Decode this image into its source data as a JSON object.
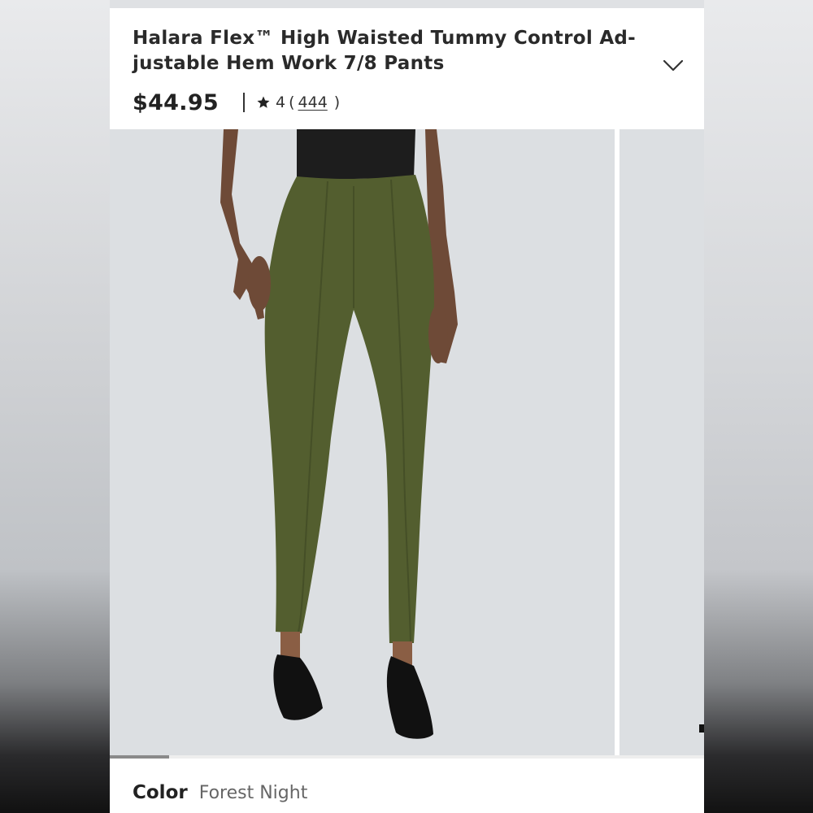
{
  "product": {
    "title": "Halara Flex™ High Waisted Tummy Control Ad-justable Hem Work 7/8 Pants",
    "price": "$44.95",
    "rating": "4",
    "review_count": "444",
    "paren_open": "(",
    "paren_close": ")"
  },
  "icons": {
    "expand": "chevron-down-icon",
    "rating": "star-icon"
  },
  "gallery": {
    "progress": 0.1,
    "images": [
      "product-photo",
      "product-photo-next"
    ]
  },
  "options": {
    "color_label": "Color",
    "color_value": "Forest Night"
  },
  "colors": {
    "pants": "#535e2f",
    "photo_bg": "#dcdfe2",
    "text": "#2a2a2a"
  }
}
